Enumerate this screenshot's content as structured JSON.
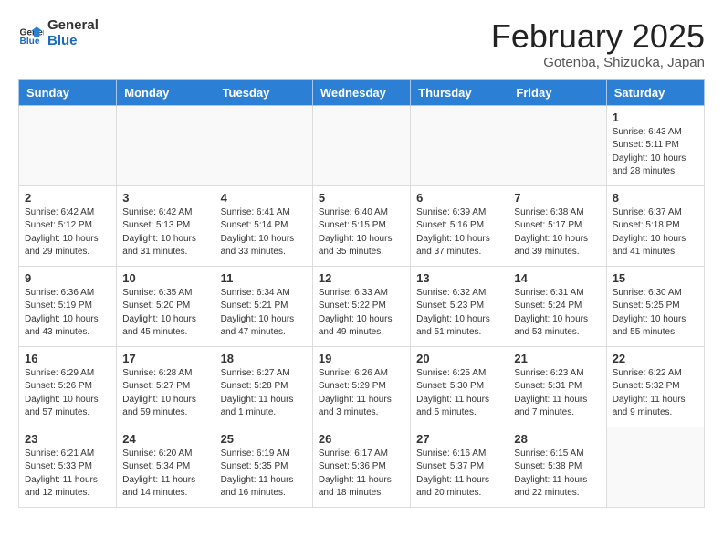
{
  "header": {
    "logo_line1": "General",
    "logo_line2": "Blue",
    "month_title": "February 2025",
    "location": "Gotenba, Shizuoka, Japan"
  },
  "weekdays": [
    "Sunday",
    "Monday",
    "Tuesday",
    "Wednesday",
    "Thursday",
    "Friday",
    "Saturday"
  ],
  "weeks": [
    [
      {
        "day": "",
        "info": ""
      },
      {
        "day": "",
        "info": ""
      },
      {
        "day": "",
        "info": ""
      },
      {
        "day": "",
        "info": ""
      },
      {
        "day": "",
        "info": ""
      },
      {
        "day": "",
        "info": ""
      },
      {
        "day": "1",
        "info": "Sunrise: 6:43 AM\nSunset: 5:11 PM\nDaylight: 10 hours and 28 minutes."
      }
    ],
    [
      {
        "day": "2",
        "info": "Sunrise: 6:42 AM\nSunset: 5:12 PM\nDaylight: 10 hours and 29 minutes."
      },
      {
        "day": "3",
        "info": "Sunrise: 6:42 AM\nSunset: 5:13 PM\nDaylight: 10 hours and 31 minutes."
      },
      {
        "day": "4",
        "info": "Sunrise: 6:41 AM\nSunset: 5:14 PM\nDaylight: 10 hours and 33 minutes."
      },
      {
        "day": "5",
        "info": "Sunrise: 6:40 AM\nSunset: 5:15 PM\nDaylight: 10 hours and 35 minutes."
      },
      {
        "day": "6",
        "info": "Sunrise: 6:39 AM\nSunset: 5:16 PM\nDaylight: 10 hours and 37 minutes."
      },
      {
        "day": "7",
        "info": "Sunrise: 6:38 AM\nSunset: 5:17 PM\nDaylight: 10 hours and 39 minutes."
      },
      {
        "day": "8",
        "info": "Sunrise: 6:37 AM\nSunset: 5:18 PM\nDaylight: 10 hours and 41 minutes."
      }
    ],
    [
      {
        "day": "9",
        "info": "Sunrise: 6:36 AM\nSunset: 5:19 PM\nDaylight: 10 hours and 43 minutes."
      },
      {
        "day": "10",
        "info": "Sunrise: 6:35 AM\nSunset: 5:20 PM\nDaylight: 10 hours and 45 minutes."
      },
      {
        "day": "11",
        "info": "Sunrise: 6:34 AM\nSunset: 5:21 PM\nDaylight: 10 hours and 47 minutes."
      },
      {
        "day": "12",
        "info": "Sunrise: 6:33 AM\nSunset: 5:22 PM\nDaylight: 10 hours and 49 minutes."
      },
      {
        "day": "13",
        "info": "Sunrise: 6:32 AM\nSunset: 5:23 PM\nDaylight: 10 hours and 51 minutes."
      },
      {
        "day": "14",
        "info": "Sunrise: 6:31 AM\nSunset: 5:24 PM\nDaylight: 10 hours and 53 minutes."
      },
      {
        "day": "15",
        "info": "Sunrise: 6:30 AM\nSunset: 5:25 PM\nDaylight: 10 hours and 55 minutes."
      }
    ],
    [
      {
        "day": "16",
        "info": "Sunrise: 6:29 AM\nSunset: 5:26 PM\nDaylight: 10 hours and 57 minutes."
      },
      {
        "day": "17",
        "info": "Sunrise: 6:28 AM\nSunset: 5:27 PM\nDaylight: 10 hours and 59 minutes."
      },
      {
        "day": "18",
        "info": "Sunrise: 6:27 AM\nSunset: 5:28 PM\nDaylight: 11 hours and 1 minute."
      },
      {
        "day": "19",
        "info": "Sunrise: 6:26 AM\nSunset: 5:29 PM\nDaylight: 11 hours and 3 minutes."
      },
      {
        "day": "20",
        "info": "Sunrise: 6:25 AM\nSunset: 5:30 PM\nDaylight: 11 hours and 5 minutes."
      },
      {
        "day": "21",
        "info": "Sunrise: 6:23 AM\nSunset: 5:31 PM\nDaylight: 11 hours and 7 minutes."
      },
      {
        "day": "22",
        "info": "Sunrise: 6:22 AM\nSunset: 5:32 PM\nDaylight: 11 hours and 9 minutes."
      }
    ],
    [
      {
        "day": "23",
        "info": "Sunrise: 6:21 AM\nSunset: 5:33 PM\nDaylight: 11 hours and 12 minutes."
      },
      {
        "day": "24",
        "info": "Sunrise: 6:20 AM\nSunset: 5:34 PM\nDaylight: 11 hours and 14 minutes."
      },
      {
        "day": "25",
        "info": "Sunrise: 6:19 AM\nSunset: 5:35 PM\nDaylight: 11 hours and 16 minutes."
      },
      {
        "day": "26",
        "info": "Sunrise: 6:17 AM\nSunset: 5:36 PM\nDaylight: 11 hours and 18 minutes."
      },
      {
        "day": "27",
        "info": "Sunrise: 6:16 AM\nSunset: 5:37 PM\nDaylight: 11 hours and 20 minutes."
      },
      {
        "day": "28",
        "info": "Sunrise: 6:15 AM\nSunset: 5:38 PM\nDaylight: 11 hours and 22 minutes."
      },
      {
        "day": "",
        "info": ""
      }
    ]
  ]
}
